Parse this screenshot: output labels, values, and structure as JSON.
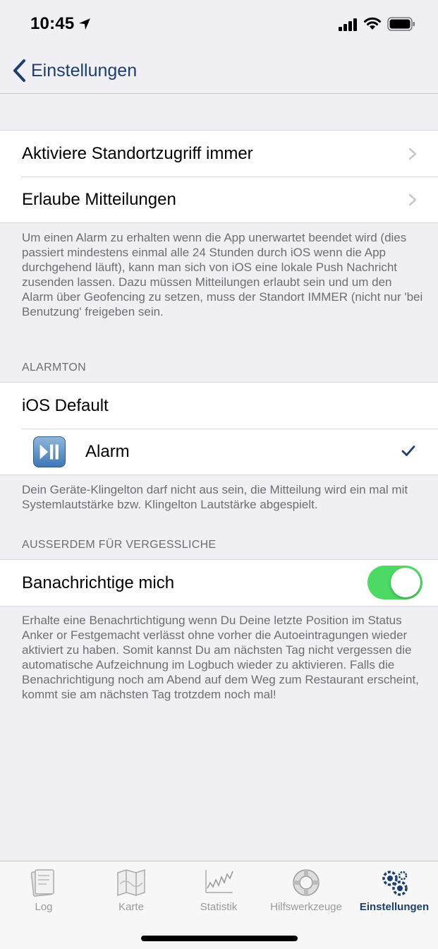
{
  "status_bar": {
    "time": "10:45"
  },
  "nav": {
    "back_label": "Einstellungen"
  },
  "permissions": {
    "items": [
      {
        "label": "Aktiviere Standortzugriff immer"
      },
      {
        "label": "Erlaube Mitteilungen"
      }
    ],
    "footer": "Um einen Alarm zu erhalten wenn die App unerwartet beendet wird (dies passiert mindestens einmal alle 24 Stunden durch iOS wenn die App durchgehend läuft), kann man sich von iOS eine lokale Push Nachricht zusenden lassen. Dazu müssen Mitteilungen erlaubt sein und um den Alarm über Geofencing zu setzen, muss der Standort IMMER (nicht nur 'bei Benutzung' freigeben sein."
  },
  "alarmton": {
    "header": "ALARMTON",
    "items": [
      {
        "label": "iOS Default"
      },
      {
        "label": "Alarm",
        "selected": true,
        "icon": "play-pause-icon"
      }
    ],
    "footer": "Dein Geräte-Klingelton darf nicht aus sein, die Mitteilung wird ein mal mit Systemlautstärke bzw. Klingelton Lautstärke abgespielt."
  },
  "vergessliche": {
    "header": "AUSSERDEM FÜR VERGESSLICHE",
    "toggle_label": "Banachrichtige mich",
    "toggle_on": true,
    "footer": "Erhalte eine Benachrtichtigung wenn Du Deine letzte Position im Status Anker or Festgemacht verlässt ohne vorher die Autoeintragungen wieder aktiviert zu haben. Somit kannst Du am nächsten Tag nicht vergessen die automatische Aufzeichnung im Logbuch wieder zu aktivieren. Falls die Benachrichtigung noch am Abend auf dem Weg zum Restaurant erscheint, kommt sie am nächsten Tag trotzdem noch mal!"
  },
  "tabs": [
    {
      "label": "Log",
      "icon": "logbook-icon"
    },
    {
      "label": "Karte",
      "icon": "map-icon"
    },
    {
      "label": "Statistik",
      "icon": "chart-icon"
    },
    {
      "label": "Hilfswerkzeuge",
      "icon": "lifebuoy-icon"
    },
    {
      "label": "Einstellungen",
      "icon": "gears-icon",
      "active": true
    }
  ],
  "colors": {
    "accent": "#1c3f6e",
    "toggle_on": "#4cd964",
    "background": "#efeff4"
  }
}
